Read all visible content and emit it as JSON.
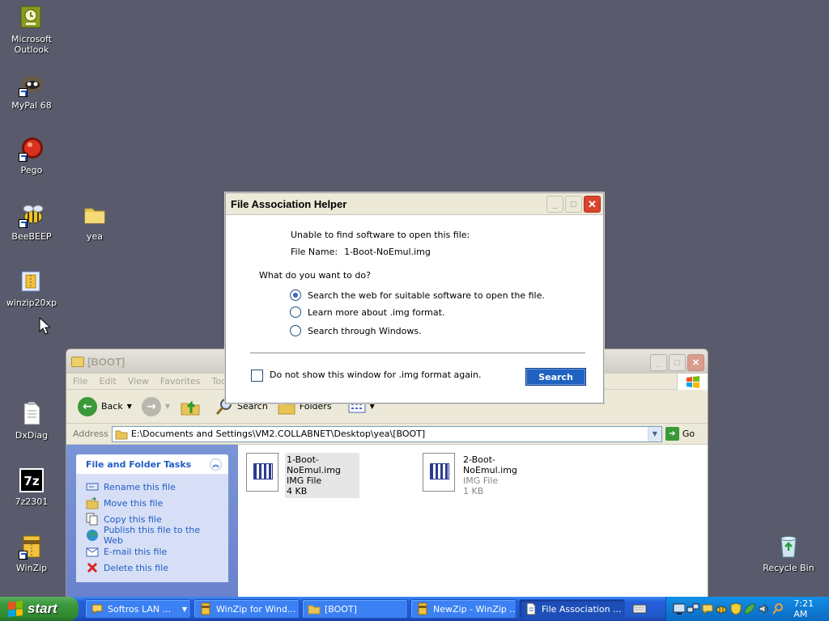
{
  "desktop": {
    "icons": [
      {
        "label": "Microsoft Outlook",
        "icon": "outlook-icon"
      },
      {
        "label": "MyPal 68",
        "icon": "mypal-icon"
      },
      {
        "label": "Pego",
        "icon": "pego-icon"
      },
      {
        "label": "BeeBEEP",
        "icon": "beebeep-icon"
      },
      {
        "label": "yea",
        "icon": "folder-icon"
      },
      {
        "label": "winzip20xp",
        "icon": "winzip-installer-icon"
      },
      {
        "label": "DxDiag",
        "icon": "dxdiag-icon"
      },
      {
        "label": "7z2301",
        "icon": "7zip-icon"
      },
      {
        "label": "WinZip",
        "icon": "winzip-icon"
      },
      {
        "label": "Recycle Bin",
        "icon": "recycle-bin-icon"
      }
    ]
  },
  "explorer": {
    "title": "[BOOT]",
    "menu": [
      "File",
      "Edit",
      "View",
      "Favorites",
      "Too"
    ],
    "toolbar": {
      "back": "Back",
      "search": "Search",
      "folders": "Folders"
    },
    "address_label": "Address",
    "address_value": "E:\\Documents and Settings\\VM2.COLLABNET\\Desktop\\yea\\[BOOT]",
    "go": "Go",
    "task_panel": {
      "title": "File and Folder Tasks",
      "items": [
        "Rename this file",
        "Move this file",
        "Copy this file",
        "Publish this file to the Web",
        "E-mail this file",
        "Delete this file"
      ]
    },
    "files": [
      {
        "name": "1-Boot-NoEmul.img",
        "type": "IMG File",
        "size": "4 KB"
      },
      {
        "name": "2-Boot-NoEmul.img",
        "type": "IMG File",
        "size": "1 KB"
      }
    ]
  },
  "dialog": {
    "title": "File Association Helper",
    "message": "Unable to find software to open this file:",
    "file_name_label": "File Name:",
    "file_name": "1-Boot-NoEmul.img",
    "question": "What do you want to do?",
    "options": [
      "Search the web for suitable software to open the file.",
      "Learn more about .img format.",
      "Search through Windows."
    ],
    "selected_option": 0,
    "checkbox_label": "Do not show this window for .img format again.",
    "search_button": "Search"
  },
  "taskbar": {
    "start": "start",
    "tasks": [
      {
        "label": "Softros LAN ...",
        "icon": "chat-icon"
      },
      {
        "label": "WinZip for Wind...",
        "icon": "winzip-icon"
      },
      {
        "label": "[BOOT]",
        "icon": "folder-icon"
      },
      {
        "label": "NewZip - WinZip ...",
        "icon": "winzip-icon"
      },
      {
        "label": "File Association ...",
        "icon": "file-association-icon"
      }
    ],
    "clock": "7:21 AM"
  }
}
